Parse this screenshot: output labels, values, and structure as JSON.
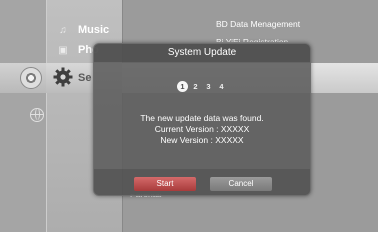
{
  "menu": {
    "items": [
      {
        "label": "Music",
        "icon": "music-note-icon"
      },
      {
        "label": "Pho",
        "icon": "photo-icon"
      },
      {
        "label": "Se",
        "icon": "gear-icon"
      }
    ]
  },
  "submenu": {
    "items": [
      {
        "label": "BD Data Menagement"
      },
      {
        "label": "Bi YiEi Registration"
      },
      {
        "label": "Parental"
      }
    ]
  },
  "dialog": {
    "title": "System Update",
    "steps": [
      "1",
      "2",
      "3",
      "4"
    ],
    "active_step": 1,
    "message_line1": "The new update data was found.",
    "message_line2": "Current Version : XXXXX",
    "message_line3": "New Version : XXXXX",
    "start_label": "Start",
    "cancel_label": "Cancel"
  },
  "colors": {
    "start_button": "#b84646",
    "dialog_bg": "#5c5c5c"
  }
}
